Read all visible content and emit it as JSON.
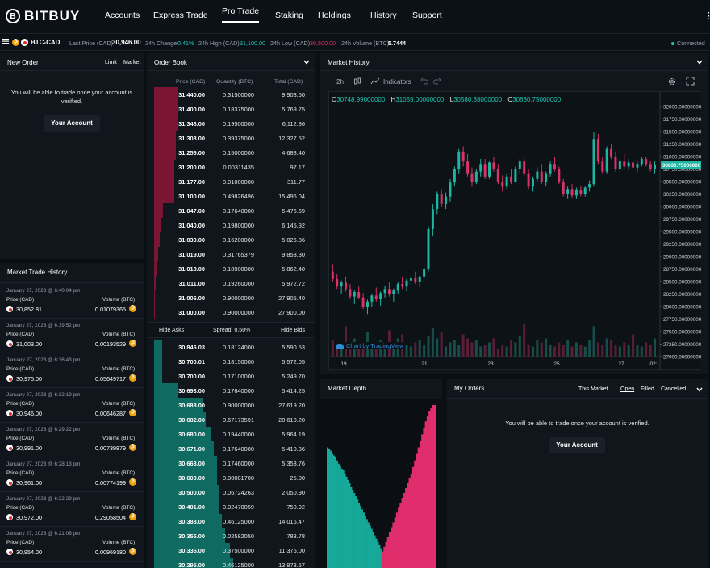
{
  "brand": {
    "name": "BITBUY",
    "mark": "B"
  },
  "nav": {
    "items": [
      "Accounts",
      "Express Trade",
      "Pro Trade",
      "Staking",
      "Holdings",
      "History",
      "Support"
    ],
    "active": "Pro Trade",
    "menu_icon": "⋮"
  },
  "ticker": {
    "pair": "BTC-CAD",
    "last_price_label": "Last Price (CAD)",
    "last_price": "30,946.00",
    "change_label": "24h Change",
    "change": "0.41%",
    "high_label": "24h High (CAD)",
    "high": "31,100.00",
    "low_label": "24h Low (CAD)",
    "low": "30,500.00",
    "volume_label": "24h Volume (BTC)",
    "volume": "5.7444",
    "status": "Connected"
  },
  "new_order": {
    "title": "New Order",
    "tab_limit": "Limit",
    "tab_market": "Market",
    "notice": "You will be able to trade once your account is verified.",
    "button": "Your Account"
  },
  "trade_history": {
    "title": "Market Trade History",
    "price_label": "Price (CAD)",
    "volume_label": "Volume (BTC)",
    "items": [
      {
        "time": "January 27, 2023 @ 6:40:04 pm",
        "price": "30,852.81",
        "volume": "0.01079365",
        "side": "red"
      },
      {
        "time": "January 27, 2023 @ 6:39:52 pm",
        "price": "31,003.00",
        "volume": "0.00193529",
        "side": "green"
      },
      {
        "time": "January 27, 2023 @ 6:36:43 pm",
        "price": "30,975.00",
        "volume": "0.05649717",
        "side": "red"
      },
      {
        "time": "January 27, 2023 @ 6:32:19 pm",
        "price": "30,946.00",
        "volume": "0.00646287",
        "side": "red"
      },
      {
        "time": "January 27, 2023 @ 6:29:22 pm",
        "price": "30,991.00",
        "volume": "0.00739879",
        "side": "red"
      },
      {
        "time": "January 27, 2023 @ 6:28:13 pm",
        "price": "30,961.00",
        "volume": "0.00774199",
        "side": "red"
      },
      {
        "time": "January 27, 2023 @ 6:22:29 pm",
        "price": "30,972.00",
        "volume": "0.29058504",
        "side": "red"
      },
      {
        "time": "January 27, 2023 @ 6:21:06 pm",
        "price": "30,954.00",
        "volume": "0.00969180",
        "side": "red"
      }
    ]
  },
  "order_book": {
    "title": "Order Book",
    "col_price": "Price (CAD)",
    "col_qty": "Quantity (BTC)",
    "col_total": "Total (CAD)",
    "hide_asks": "Hide Asks",
    "spread": "Spread: 0.50%",
    "hide_bids": "Hide Bids",
    "asks": [
      {
        "price": "31,440.00",
        "qty": "0.31500000",
        "total": "9,903.60",
        "depth": 0.15
      },
      {
        "price": "31,400.00",
        "qty": "0.18375000",
        "total": "5,769.75",
        "depth": 0.15
      },
      {
        "price": "31,348.00",
        "qty": "0.19500000",
        "total": "6,112.86",
        "depth": 0.15
      },
      {
        "price": "31,308.00",
        "qty": "0.39375000",
        "total": "12,327.52",
        "depth": 0.135
      },
      {
        "price": "31,256.00",
        "qty": "0.15000000",
        "total": "4,688.40",
        "depth": 0.135
      },
      {
        "price": "31,200.00",
        "qty": "0.00311435",
        "total": "97.17",
        "depth": 0.125
      },
      {
        "price": "31,177.00",
        "qty": "0.01000000",
        "total": "311.77",
        "depth": 0.125
      },
      {
        "price": "31,100.00",
        "qty": "0.49826496",
        "total": "15,496.04",
        "depth": 0.125
      },
      {
        "price": "31,047.00",
        "qty": "0.17640000",
        "total": "5,476.69",
        "depth": 0.055
      },
      {
        "price": "31,040.00",
        "qty": "0.19800000",
        "total": "6,145.92",
        "depth": 0.045
      },
      {
        "price": "31,030.00",
        "qty": "0.16200000",
        "total": "5,026.86",
        "depth": 0.035
      },
      {
        "price": "31,019.00",
        "qty": "0.31765379",
        "total": "9,853.30",
        "depth": 0.025
      },
      {
        "price": "31,018.00",
        "qty": "0.18900000",
        "total": "5,862.40",
        "depth": 0.015
      },
      {
        "price": "31,011.00",
        "qty": "0.19260000",
        "total": "5,972.72",
        "depth": 0.01
      },
      {
        "price": "31,006.00",
        "qty": "0.90000000",
        "total": "27,905.40",
        "depth": 0.005
      },
      {
        "price": "31,000.00",
        "qty": "0.90000000",
        "total": "27,900.00",
        "depth": 0.002
      }
    ],
    "bids": [
      {
        "price": "30,846.03",
        "qty": "0.18124000",
        "total": "5,590.53",
        "depth": 0.05
      },
      {
        "price": "30,700.01",
        "qty": "0.18150000",
        "total": "5,572.05",
        "depth": 0.05
      },
      {
        "price": "30,700.00",
        "qty": "0.17100000",
        "total": "5,249.70",
        "depth": 0.05
      },
      {
        "price": "30,693.00",
        "qty": "0.17640000",
        "total": "5,414.25",
        "depth": 0.15
      },
      {
        "price": "30,688.00",
        "qty": "0.90000000",
        "total": "27,619.20",
        "depth": 0.3
      },
      {
        "price": "30,682.00",
        "qty": "0.67173591",
        "total": "20,610.20",
        "depth": 0.32
      },
      {
        "price": "30,680.00",
        "qty": "0.19440000",
        "total": "5,964.19",
        "depth": 0.35
      },
      {
        "price": "30,671.00",
        "qty": "0.17640000",
        "total": "5,410.36",
        "depth": 0.37
      },
      {
        "price": "30,663.00",
        "qty": "0.17460000",
        "total": "5,353.76",
        "depth": 0.39
      },
      {
        "price": "30,600.00",
        "qty": "0.00081700",
        "total": "25.00",
        "depth": 0.39
      },
      {
        "price": "30,500.00",
        "qty": "0.06724263",
        "total": "2,050.90",
        "depth": 0.4
      },
      {
        "price": "30,401.00",
        "qty": "0.02470059",
        "total": "750.92",
        "depth": 0.4
      },
      {
        "price": "30,388.00",
        "qty": "0.46125000",
        "total": "14,016.47",
        "depth": 0.42
      },
      {
        "price": "30,355.00",
        "qty": "0.02582050",
        "total": "783.78",
        "depth": 0.44
      },
      {
        "price": "30,336.00",
        "qty": "0.37500000",
        "total": "11,376.00",
        "depth": 0.47
      },
      {
        "price": "30,295.00",
        "qty": "0.46125000",
        "total": "13,973.57",
        "depth": 0.49
      }
    ]
  },
  "market_history": {
    "title": "Market History",
    "interval": "2h",
    "indicators": "Indicators",
    "ohlc": {
      "o_label": "O",
      "o": "30748.99000000",
      "h_label": "H",
      "h": "31059.00000000",
      "l_label": "L",
      "l": "30580.38000000",
      "c_label": "C",
      "c": "30830.75000000"
    },
    "watermark": "Chart by TradingView",
    "current_price_tag": "30830.75000000"
  },
  "chart_data": {
    "type": "candlestick",
    "ylim": [
      27000,
      32000
    ],
    "y_ticks": [
      "32000.00000000",
      "31750.00000000",
      "31500.00000000",
      "31250.00000000",
      "31000.00000000",
      "30750.00000000",
      "30500.00000000",
      "30250.00000000",
      "30000.00000000",
      "29750.00000000",
      "29500.00000000",
      "29250.00000000",
      "29000.00000000",
      "28750.00000000",
      "28500.00000000",
      "28250.00000000",
      "28000.00000000",
      "27750.00000000",
      "27500.00000000",
      "27250.00000000",
      "27000.00000000"
    ],
    "x_ticks": [
      "19",
      "21",
      "23",
      "25",
      "27",
      "02:"
    ],
    "last_price": 30830.75,
    "candles": [
      [
        28700,
        28850,
        28500,
        28550
      ],
      [
        28550,
        28650,
        28350,
        28400
      ],
      [
        28400,
        28520,
        28250,
        28480
      ],
      [
        28480,
        28600,
        28300,
        28350
      ],
      [
        28350,
        28450,
        28150,
        28200
      ],
      [
        28200,
        28330,
        28050,
        28290
      ],
      [
        28290,
        28400,
        28150,
        28180
      ],
      [
        28180,
        28270,
        27950,
        28000
      ],
      [
        28000,
        28140,
        27850,
        28100
      ],
      [
        28100,
        28260,
        28000,
        28220
      ],
      [
        28220,
        28380,
        28100,
        28150
      ],
      [
        28150,
        28300,
        28020,
        28270
      ],
      [
        28270,
        28420,
        28180,
        28350
      ],
      [
        28350,
        28480,
        28200,
        28250
      ],
      [
        28250,
        28360,
        28100,
        28320
      ],
      [
        28320,
        28500,
        28250,
        28450
      ],
      [
        28450,
        28600,
        28350,
        28400
      ],
      [
        28400,
        28560,
        28300,
        28520
      ],
      [
        28520,
        28650,
        28420,
        28580
      ],
      [
        28580,
        28700,
        28450,
        28500
      ],
      [
        28500,
        28620,
        28380,
        28600
      ],
      [
        28600,
        28800,
        28550,
        28750
      ],
      [
        28750,
        29600,
        28700,
        29550
      ],
      [
        29550,
        30050,
        29400,
        29950
      ],
      [
        29950,
        30300,
        29850,
        30250
      ],
      [
        30250,
        30350,
        30000,
        30050
      ],
      [
        30050,
        30280,
        29950,
        30200
      ],
      [
        30200,
        30550,
        30100,
        30480
      ],
      [
        30480,
        30800,
        30400,
        30750
      ],
      [
        30750,
        31150,
        30650,
        31100
      ],
      [
        31100,
        31200,
        30800,
        30900
      ],
      [
        30900,
        31050,
        30600,
        30650
      ],
      [
        30650,
        30780,
        30400,
        30500
      ],
      [
        30500,
        30750,
        30450,
        30700
      ],
      [
        30700,
        30950,
        30600,
        30850
      ],
      [
        30850,
        30950,
        30550,
        30600
      ],
      [
        30600,
        30900,
        30550,
        30880
      ],
      [
        30880,
        31000,
        30700,
        30750
      ],
      [
        30750,
        30850,
        30450,
        30500
      ],
      [
        30500,
        30620,
        30300,
        30400
      ],
      [
        30400,
        30650,
        30350,
        30600
      ],
      [
        30600,
        30750,
        30450,
        30500
      ],
      [
        30500,
        30800,
        30480,
        30750
      ],
      [
        30750,
        30950,
        30650,
        30900
      ],
      [
        30900,
        31000,
        30600,
        30650
      ],
      [
        30650,
        30750,
        30350,
        30400
      ],
      [
        30400,
        30600,
        30300,
        30550
      ],
      [
        30550,
        30780,
        30500,
        30700
      ],
      [
        30700,
        30850,
        30450,
        30500
      ],
      [
        30500,
        30700,
        30400,
        30650
      ],
      [
        30650,
        30900,
        30600,
        30850
      ],
      [
        30850,
        31000,
        30700,
        30750
      ],
      [
        30750,
        30800,
        30450,
        30500
      ],
      [
        30500,
        30550,
        30200,
        30250
      ],
      [
        30250,
        30400,
        30150,
        30350
      ],
      [
        30350,
        30450,
        30180,
        30220
      ],
      [
        30220,
        30380,
        30150,
        30330
      ],
      [
        30330,
        30420,
        30200,
        30250
      ],
      [
        30250,
        30400,
        30200,
        30380
      ],
      [
        30380,
        30520,
        30300,
        30450
      ],
      [
        30450,
        31500,
        30400,
        31350
      ],
      [
        31350,
        31450,
        30850,
        30900
      ],
      [
        30900,
        31000,
        30650,
        30700
      ],
      [
        30700,
        31200,
        30650,
        31150
      ],
      [
        31150,
        31250,
        30950,
        31000
      ],
      [
        31000,
        31100,
        30700,
        30750
      ],
      [
        30750,
        30950,
        30680,
        30900
      ],
      [
        30900,
        31050,
        30750,
        30800
      ],
      [
        30800,
        30950,
        30720,
        30880
      ],
      [
        30880,
        30980,
        30750,
        30780
      ],
      [
        30780,
        30900,
        30700,
        30850
      ],
      [
        30850,
        31000,
        30800,
        30950
      ],
      [
        30950,
        31000,
        30800,
        30850
      ],
      [
        30850,
        30920,
        30700,
        30750
      ],
      [
        30750,
        30900,
        30650,
        30830
      ]
    ],
    "volumes": [
      0.8,
      0.4,
      0.5,
      1.5,
      0.6,
      0.9,
      0.7,
      0.5,
      1.2,
      0.4,
      0.6,
      0.8,
      0.7,
      1.3,
      0.5,
      0.9,
      1.1,
      0.6,
      0.5,
      0.7,
      0.8,
      0.6,
      1.0,
      1.4,
      0.9,
      1.2,
      0.5,
      0.7,
      0.8,
      0.6,
      1.1,
      0.9,
      0.7,
      0.8,
      0.5,
      0.6,
      0.7,
      0.9,
      0.4,
      0.6,
      0.5,
      0.8,
      0.7,
      1.0,
      1.6,
      0.6,
      0.5,
      0.8,
      0.7,
      0.9,
      0.6,
      0.5,
      0.7,
      0.6,
      0.8,
      0.5,
      0.7,
      0.6,
      0.5,
      0.8,
      1.5,
      0.7,
      0.6,
      0.9,
      0.8,
      0.6,
      0.5,
      0.7,
      0.6,
      1.1,
      0.6,
      0.5,
      0.7,
      0.6,
      0.9
    ]
  },
  "market_depth": {
    "title": "Market Depth",
    "bid_levels": [
      0.74,
      0.73,
      0.72,
      0.7,
      0.69,
      0.68,
      0.66,
      0.64,
      0.63,
      0.61,
      0.6,
      0.58,
      0.56,
      0.54,
      0.52,
      0.5,
      0.48,
      0.46,
      0.44,
      0.42,
      0.4,
      0.38,
      0.36,
      0.34,
      0.32,
      0.3,
      0.28,
      0.26,
      0.24,
      0.22,
      0.2,
      0.18,
      0.16,
      0.14,
      0.12,
      0.1
    ],
    "ask_levels": [
      0.1,
      0.13,
      0.16,
      0.19,
      0.22,
      0.25,
      0.28,
      0.31,
      0.34,
      0.37,
      0.4,
      0.43,
      0.46,
      0.49,
      0.52,
      0.55,
      0.58,
      0.62,
      0.66,
      0.7,
      0.74,
      0.78,
      0.82,
      0.86,
      0.9,
      0.93,
      0.96,
      0.98,
      1.0,
      1.0
    ]
  },
  "my_orders": {
    "title": "My Orders",
    "filter": "This Market",
    "tab_open": "Open",
    "tab_filled": "Filled",
    "tab_cancelled": "Cancelled",
    "notice": "You will be able to trade once your account is verified.",
    "button": "Your Account"
  }
}
